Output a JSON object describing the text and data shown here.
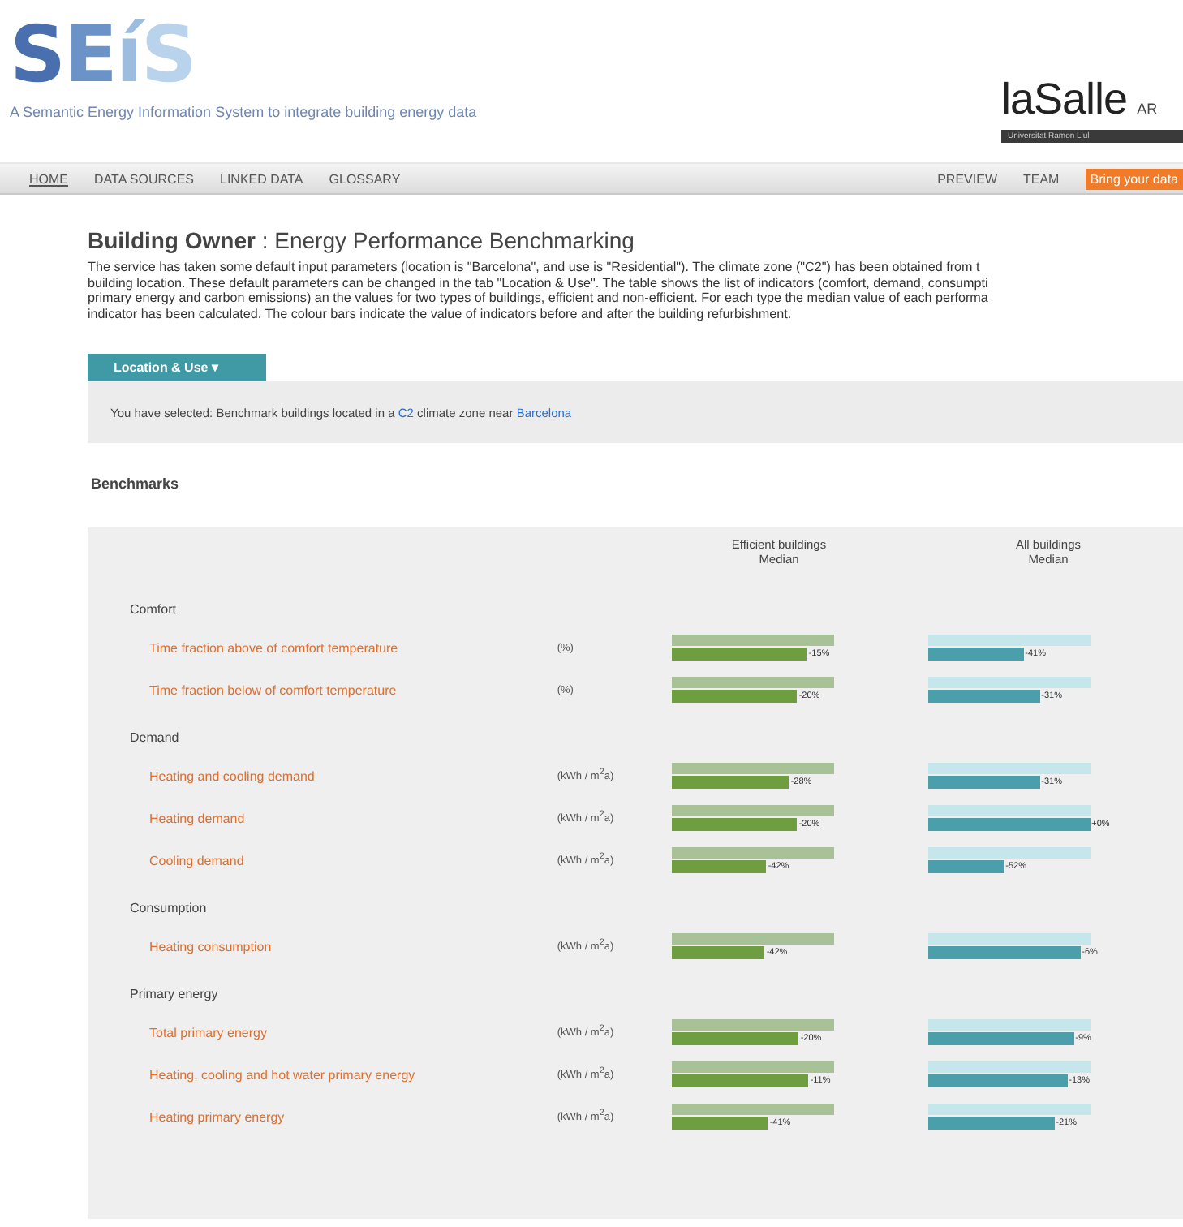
{
  "logo": {
    "text": "SEíS",
    "tagline": "A Semantic Energy Information System to integrate building energy data"
  },
  "partner": {
    "name": "laSalle",
    "suffix": "AR",
    "band": "Universitat Ramon Llul"
  },
  "nav": {
    "left": [
      {
        "label": "HOME",
        "selected": true
      },
      {
        "label": "DATA SOURCES",
        "selected": false
      },
      {
        "label": "LINKED DATA",
        "selected": false
      },
      {
        "label": "GLOSSARY",
        "selected": false
      }
    ],
    "right": [
      {
        "label": "PREVIEW",
        "kind": "link"
      },
      {
        "label": "TEAM",
        "kind": "link"
      },
      {
        "label": "Bring your data",
        "kind": "button"
      }
    ]
  },
  "heading": {
    "role": "Building Owner",
    "title": ": Energy Performance Benchmarking"
  },
  "intro": [
    "The service has taken some default input parameters (location is \"Barcelona\", and use is \"Residential\"). The climate zone (\"C2\") has been obtained from t",
    "building location. These default parameters can be changed in the tab \"Location & Use\". The table shows the list of indicators (comfort, demand, consumpti",
    "primary energy and carbon emissions) an the values for two types of buildings, efficient and non-efficient. For each type the median value of each performa",
    "indicator has been calculated. The colour bars indicate the value of indicators before and after the building refurbishment."
  ],
  "tab": {
    "label": "Location & Use ▾"
  },
  "selection": {
    "before": "You have selected: Benchmark buildings located in a ",
    "zone": "C2",
    "middle": " climate zone near ",
    "city": "Barcelona"
  },
  "benchmarks": {
    "title": "Benchmarks",
    "columns": [
      {
        "line1": "Efficient buildings",
        "line2": "Median"
      },
      {
        "line1": "All buildings",
        "line2": "Median"
      }
    ],
    "groups": [
      {
        "name": "Comfort",
        "rows": [
          {
            "label": "Time fraction above of comfort temperature",
            "unit": "(%)",
            "efficient": {
              "level": 0.83,
              "reading": "-15%"
            },
            "all": {
              "level": 0.59,
              "reading": "-41%"
            }
          },
          {
            "label": "Time fraction below of comfort temperature",
            "unit": "(%)",
            "efficient": {
              "level": 0.77,
              "reading": "-20%"
            },
            "all": {
              "level": 0.69,
              "reading": "-31%"
            }
          }
        ]
      },
      {
        "name": "Demand",
        "rows": [
          {
            "label": "Heating and cooling demand",
            "unit": "(kWh / m$^{2}$a)",
            "efficient": {
              "level": 0.72,
              "reading": "-28%"
            },
            "all": {
              "level": 0.69,
              "reading": "-31%"
            }
          },
          {
            "label": "Heating demand",
            "unit": "(kWh / m$^{2}$a)",
            "efficient": {
              "level": 0.77,
              "reading": "-20%"
            },
            "all": {
              "level": 1.0,
              "reading": "+0%"
            }
          },
          {
            "label": "Cooling demand",
            "unit": "(kWh / m$^{2}$a)",
            "efficient": {
              "level": 0.58,
              "reading": "-42%"
            },
            "all": {
              "level": 0.47,
              "reading": "-52%"
            }
          }
        ]
      },
      {
        "name": "Consumption",
        "rows": [
          {
            "label": "Heating consumption",
            "unit": "(kWh / m$^{2}$a)",
            "efficient": {
              "level": 0.57,
              "reading": "-42%"
            },
            "all": {
              "level": 0.94,
              "reading": "-6%"
            }
          }
        ]
      },
      {
        "name": "Primary energy",
        "rows": [
          {
            "label": "Total primary energy",
            "unit": "(kWh / m$^{2}$a)",
            "efficient": {
              "level": 0.78,
              "reading": "-20%"
            },
            "all": {
              "level": 0.9,
              "reading": "-9%"
            }
          },
          {
            "label": "Heating, cooling and hot water primary energy",
            "unit": "(kWh / m$^{2}$a)",
            "efficient": {
              "level": 0.84,
              "reading": "-11%"
            },
            "all": {
              "level": 0.86,
              "reading": "-13%"
            }
          },
          {
            "label": "Heating primary energy",
            "unit": "(kWh / m$^{2}$a)",
            "efficient": {
              "level": 0.59,
              "reading": "-41%"
            },
            "all": {
              "level": 0.78,
              "reading": "-21%"
            }
          }
        ]
      }
    ]
  }
}
